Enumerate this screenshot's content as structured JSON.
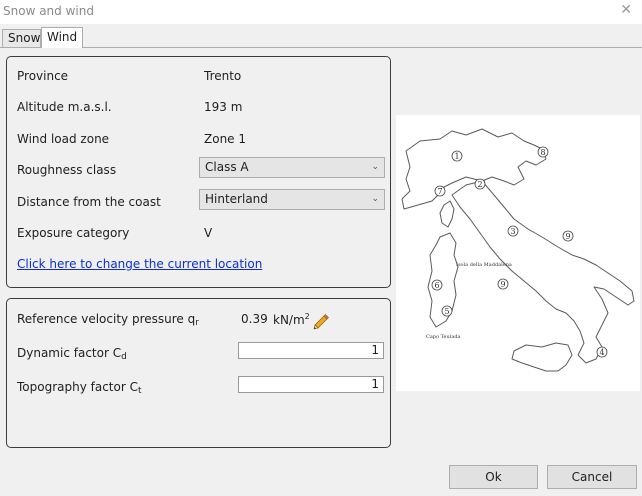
{
  "window": {
    "title": "Snow and wind"
  },
  "tabs": [
    {
      "label": "Snow"
    },
    {
      "label": "Wind"
    }
  ],
  "location": {
    "province_label": "Province",
    "province_value": "Trento",
    "altitude_label": "Altitude m.a.s.l.",
    "altitude_value": "193 m",
    "zone_label": "Wind load zone",
    "zone_value": "Zone 1",
    "roughness_label": "Roughness class",
    "roughness_value": "Class A",
    "distance_label": "Distance from the coast",
    "distance_value": "Hinterland",
    "exposure_label": "Exposure category",
    "exposure_value": "V",
    "change_link": "Click here to change the current location"
  },
  "factors": {
    "qr_label": "Reference velocity pressure q",
    "qr_sub": "r",
    "qr_value": "0.39",
    "qr_unit": "kN/m",
    "qr_unit_sup": "2",
    "cd_label": "Dynamic factor C",
    "cd_sub": "d",
    "cd_value": "1",
    "ct_label": "Topography factor C",
    "ct_sub": "t",
    "ct_value": "1"
  },
  "map": {
    "zones": [
      "1",
      "2",
      "3",
      "4",
      "5",
      "6",
      "7",
      "8",
      "9"
    ],
    "labels": [
      "Isola della Maddalena",
      "Capo Teulada"
    ]
  },
  "buttons": {
    "ok": "Ok",
    "cancel": "Cancel"
  }
}
